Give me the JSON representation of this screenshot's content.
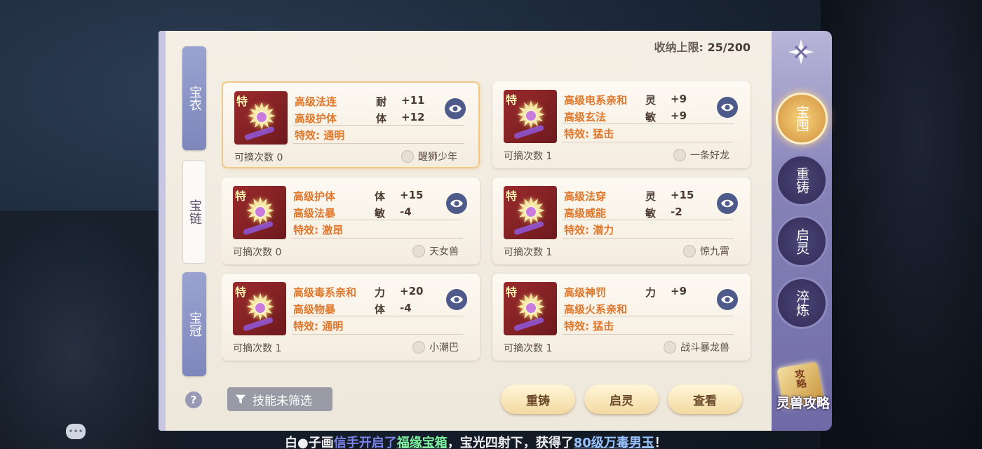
{
  "capacity": {
    "label": "收纳上限: ",
    "value": "25/200"
  },
  "left_tabs": [
    {
      "label": "宝衣",
      "state": "inactive"
    },
    {
      "label": "宝链",
      "state": "active"
    },
    {
      "label": "宝冠",
      "state": "inactive"
    }
  ],
  "cards": [
    {
      "tag": "特",
      "line1": {
        "name": "高级法连",
        "stat": "耐",
        "value": "+11"
      },
      "line2": {
        "name": "高级护体",
        "stat": "体",
        "value": "+12"
      },
      "effect": "特效: 通明",
      "count": "可摘次数 0",
      "owner": "醒狮少年",
      "selected": true
    },
    {
      "tag": "特",
      "line1": {
        "name": "高级电系亲和",
        "stat": "灵",
        "value": "+9"
      },
      "line2": {
        "name": "高级玄法",
        "stat": "敏",
        "value": "+9"
      },
      "effect": "特效: 猛击",
      "count": "可摘次数 1",
      "owner": "一条好龙",
      "selected": false
    },
    {
      "tag": "特",
      "line1": {
        "name": "高级护体",
        "stat": "体",
        "value": "+15"
      },
      "line2": {
        "name": "高级法暴",
        "stat": "敏",
        "value": "-4"
      },
      "effect": "特效: 激昂",
      "count": "可摘次数 0",
      "owner": "天女兽",
      "selected": false
    },
    {
      "tag": "特",
      "line1": {
        "name": "高级法穿",
        "stat": "灵",
        "value": "+15"
      },
      "line2": {
        "name": "高级威能",
        "stat": "敏",
        "value": "-2"
      },
      "effect": "特效: 潜力",
      "count": "可摘次数 1",
      "owner": "惊九霄",
      "selected": false
    },
    {
      "tag": "特",
      "line1": {
        "name": "高级毒系亲和",
        "stat": "力",
        "value": "+20"
      },
      "line2": {
        "name": "高级物暴",
        "stat": "体",
        "value": "-4"
      },
      "effect": "特效: 通明",
      "count": "可摘次数 1",
      "owner": "小潮巴",
      "selected": false
    },
    {
      "tag": "特",
      "line1": {
        "name": "高级神罚",
        "stat": "力",
        "value": "+9"
      },
      "line2": {
        "name": "高级火系亲和",
        "stat": "",
        "value": ""
      },
      "effect": "特效: 猛击",
      "count": "可摘次数 1",
      "owner": "战斗暴龙兽",
      "selected": false
    }
  ],
  "filter": {
    "label": "技能未筛选",
    "icon": "funnel-icon"
  },
  "help": {
    "label": "?"
  },
  "actions": {
    "reforge": "重铸",
    "awaken": "启灵",
    "view": "查看"
  },
  "right_nav": [
    {
      "label": "宝囤",
      "active": true
    },
    {
      "label": "重铸",
      "active": false
    },
    {
      "label": "启灵",
      "active": false
    },
    {
      "label": "淬炼",
      "active": false
    }
  ],
  "guide": {
    "book_text": "攻略",
    "label": "灵兽攻略"
  },
  "marquee": {
    "player": "白●子画",
    "text1": "信手开启了",
    "item1": "福缘宝箱",
    "text2": "，宝光四射下，获得了",
    "item2": "80级万毒男玉",
    "text3": "！"
  },
  "colors": {
    "accent": "#e0782c",
    "panel": "#f4efe4",
    "nav": "#8582b8",
    "active_nav": "#f7d27a"
  }
}
